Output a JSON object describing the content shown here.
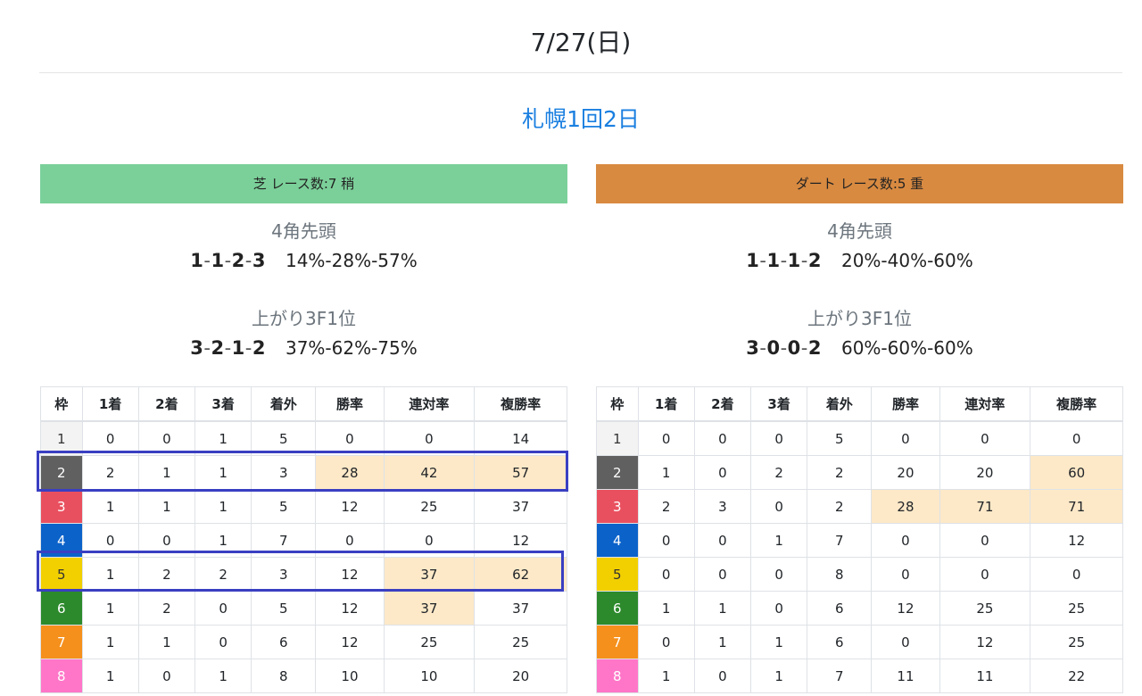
{
  "header": {
    "date": "7/27(日)"
  },
  "venue": {
    "title": "札幌1回2日"
  },
  "colors": {
    "turf": "#7bd099",
    "dirt": "#d88a41",
    "venue_link": "#1a7fe0",
    "highlight": "#fde9c8",
    "box": "#3a3fc2"
  },
  "columns": [
    "枠",
    "1着",
    "2着",
    "3着",
    "着外",
    "勝率",
    "連対率",
    "複勝率"
  ],
  "panels": [
    {
      "header": "芝 レース数:7 稍",
      "corner_label": "4角先頭",
      "corner_seq": [
        "1",
        "1",
        "2",
        "3"
      ],
      "corner_pct": "14%-28%-57%",
      "last3f_label": "上がり3F1位",
      "last3f_seq": [
        "3",
        "2",
        "1",
        "2"
      ],
      "last3f_pct": "37%-62%-75%",
      "rows": [
        [
          "1",
          "0",
          "0",
          "1",
          "5",
          "0",
          "0",
          "14"
        ],
        [
          "2",
          "2",
          "1",
          "1",
          "3",
          "28",
          "42",
          "57"
        ],
        [
          "3",
          "1",
          "1",
          "1",
          "5",
          "12",
          "25",
          "37"
        ],
        [
          "4",
          "0",
          "0",
          "1",
          "7",
          "0",
          "0",
          "12"
        ],
        [
          "5",
          "1",
          "2",
          "2",
          "3",
          "12",
          "37",
          "62"
        ],
        [
          "6",
          "1",
          "2",
          "0",
          "5",
          "12",
          "37",
          "37"
        ],
        [
          "7",
          "1",
          "1",
          "0",
          "6",
          "12",
          "25",
          "25"
        ],
        [
          "8",
          "1",
          "0",
          "1",
          "8",
          "10",
          "10",
          "20"
        ]
      ]
    },
    {
      "header": "ダート レース数:5 重",
      "corner_label": "4角先頭",
      "corner_seq": [
        "1",
        "1",
        "1",
        "2"
      ],
      "corner_pct": "20%-40%-60%",
      "last3f_label": "上がり3F1位",
      "last3f_seq": [
        "3",
        "0",
        "0",
        "2"
      ],
      "last3f_pct": "60%-60%-60%",
      "rows": [
        [
          "1",
          "0",
          "0",
          "0",
          "5",
          "0",
          "0",
          "0"
        ],
        [
          "2",
          "1",
          "0",
          "2",
          "2",
          "20",
          "20",
          "60"
        ],
        [
          "3",
          "2",
          "3",
          "0",
          "2",
          "28",
          "71",
          "71"
        ],
        [
          "4",
          "0",
          "0",
          "1",
          "7",
          "0",
          "0",
          "12"
        ],
        [
          "5",
          "0",
          "0",
          "0",
          "8",
          "0",
          "0",
          "0"
        ],
        [
          "6",
          "1",
          "1",
          "0",
          "6",
          "12",
          "25",
          "25"
        ],
        [
          "7",
          "0",
          "1",
          "1",
          "6",
          "0",
          "12",
          "25"
        ],
        [
          "8",
          "1",
          "0",
          "1",
          "7",
          "11",
          "11",
          "22"
        ]
      ]
    }
  ]
}
